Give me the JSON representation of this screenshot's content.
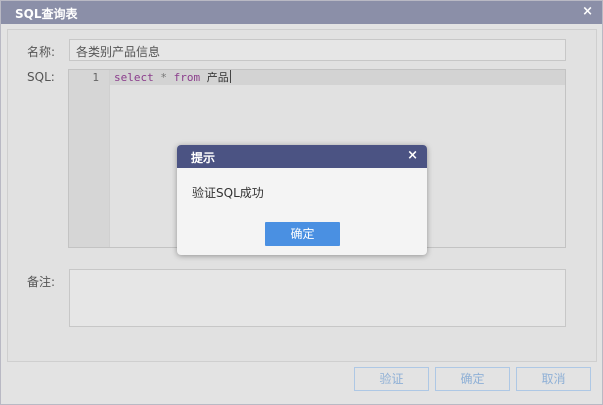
{
  "window": {
    "title": "SQL查询表",
    "close_glyph": "×"
  },
  "form": {
    "name_label": "名称:",
    "name_value": "各类别产品信息",
    "sql_label": "SQL:",
    "remark_label": "备注:",
    "remark_value": ""
  },
  "editor": {
    "line_number": "1",
    "tokens": {
      "kw1": "select",
      "op": "*",
      "kw2": "from",
      "ident": "产品"
    }
  },
  "buttons": {
    "verify": "验证",
    "ok": "确定",
    "cancel": "取消"
  },
  "dialog": {
    "title": "提示",
    "close_glyph": "×",
    "message": "验证SQL成功",
    "ok_label": "确定"
  },
  "colors": {
    "titlebar": "#8b8fa8",
    "dialog_header": "#4b5383",
    "primary_button": "#4a90e2",
    "keyword": "#8b3d8c"
  }
}
